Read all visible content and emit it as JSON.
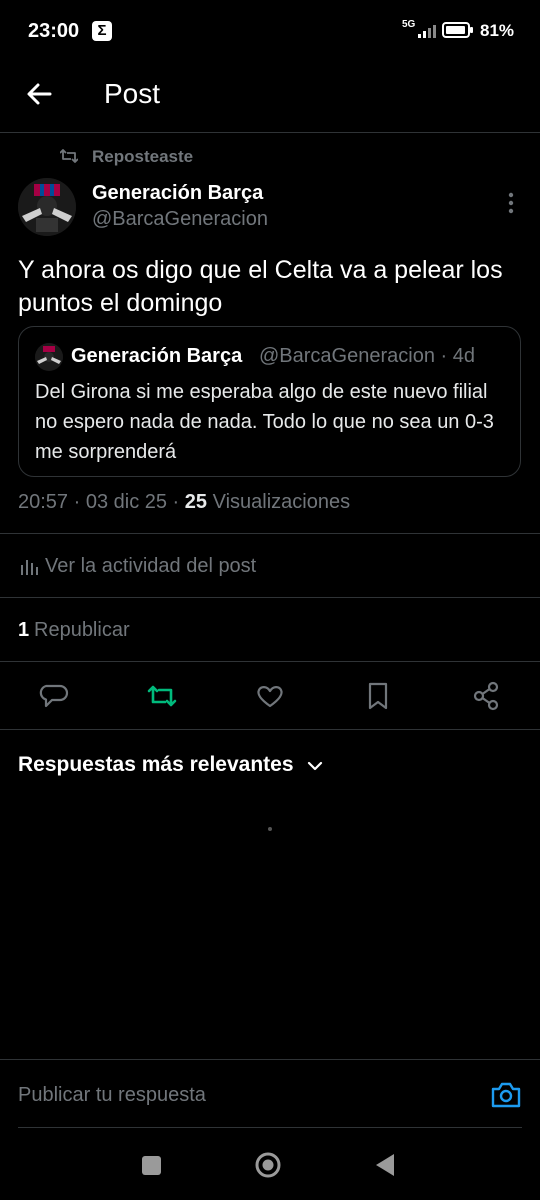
{
  "status_bar": {
    "time": "23:00",
    "notification_icon": "sigma-icon",
    "network": "5G",
    "battery": "81%"
  },
  "header": {
    "title": "Post",
    "back_icon": "arrow-left-icon"
  },
  "post": {
    "repost_label": "Reposteaste",
    "author_name": "Generación Barça",
    "author_handle": "@BarcaGeneracion",
    "text": "Y ahora os digo que el Celta va a pelear los puntos el domingo",
    "quote": {
      "name": "Generación Barça",
      "meta": "@BarcaGeneracion · 4d",
      "text": "Del Girona si me esperaba algo de este nuevo filial no espero nada de nada. Todo lo que no sea un 0-3 me sorprenderá"
    },
    "timestamp": "20:57 · 03 dic 25 · ",
    "views_count": "25",
    "views_label": " Visualizaciones",
    "activity_label": "Ver la actividad del post",
    "reposts_count": "1",
    "reposts_label": "Republicar"
  },
  "actions": [
    "reply-icon",
    "repost-icon",
    "like-icon",
    "bookmark-icon",
    "share-icon"
  ],
  "replies": {
    "sort_label": "Respuestas más relevantes"
  },
  "composer": {
    "placeholder": "Publicar tu respuesta"
  },
  "colors": {
    "background": "#000000",
    "muted": "#71767b",
    "divider": "#2f3336",
    "repost_active": "#00ba7c",
    "accent": "#1d9bf0"
  }
}
